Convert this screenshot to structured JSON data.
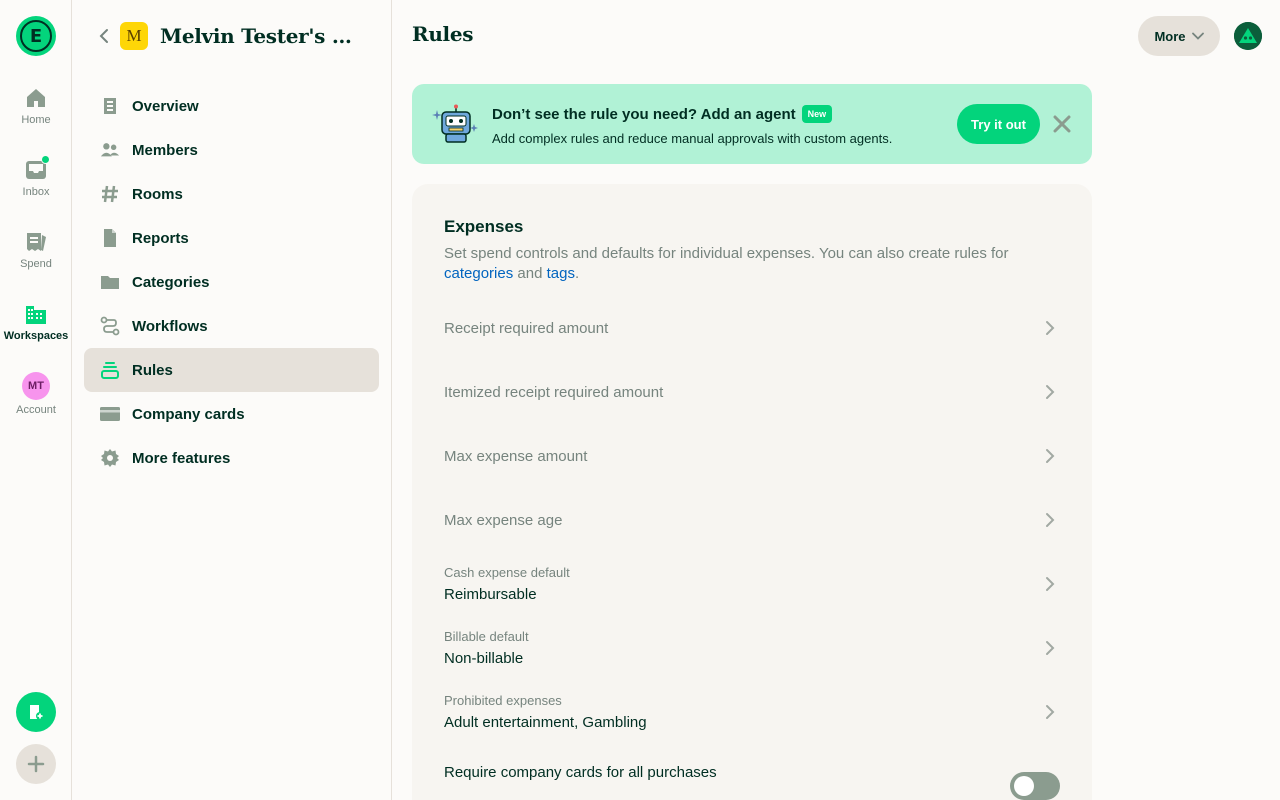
{
  "rail": {
    "logo_letter": "E",
    "items": [
      {
        "label": "Home",
        "icon": "home-icon"
      },
      {
        "label": "Inbox",
        "icon": "inbox-icon"
      },
      {
        "label": "Spend",
        "icon": "receipt-icon"
      },
      {
        "label": "Workspaces",
        "icon": "building-icon",
        "active": true
      },
      {
        "label": "Account",
        "icon": "avatar"
      }
    ],
    "account_initials": "MT"
  },
  "workspace": {
    "badge_letter": "M",
    "name": "Melvin Tester's Workspace"
  },
  "nav": {
    "items": [
      {
        "label": "Overview",
        "icon": "document-icon"
      },
      {
        "label": "Members",
        "icon": "users-icon"
      },
      {
        "label": "Rooms",
        "icon": "hashtag-icon"
      },
      {
        "label": "Reports",
        "icon": "file-icon"
      },
      {
        "label": "Categories",
        "icon": "folder-icon"
      },
      {
        "label": "Workflows",
        "icon": "workflow-icon"
      },
      {
        "label": "Rules",
        "icon": "rules-icon",
        "active": true
      },
      {
        "label": "Company cards",
        "icon": "card-icon"
      },
      {
        "label": "More features",
        "icon": "gear-icon"
      }
    ]
  },
  "header": {
    "title": "Rules",
    "more_label": "More"
  },
  "banner": {
    "title": "Don’t see the rule you need? Add an agent",
    "badge": "New",
    "subtitle": "Add complex rules and reduce manual approvals with custom agents.",
    "cta": "Try it out"
  },
  "expenses": {
    "title": "Expenses",
    "desc_prefix": "Set spend controls and defaults for individual expenses. You can also create rules for ",
    "link_categories": "categories",
    "desc_and": " and ",
    "link_tags": "tags",
    "desc_suffix": ".",
    "rows": [
      {
        "label": "Receipt required amount"
      },
      {
        "label": "Itemized receipt required amount"
      },
      {
        "label": "Max expense amount"
      },
      {
        "label": "Max expense age"
      },
      {
        "small": "Cash expense default",
        "value": "Reimbursable"
      },
      {
        "small": "Billable default",
        "value": "Non-billable"
      },
      {
        "small": "Prohibited expenses",
        "value": "Adult entertainment, Gambling"
      }
    ],
    "toggle_label": "Require company cards for all purchases",
    "toggle_on": false
  },
  "colors": {
    "accent": "#03d47c",
    "banner_bg": "#b1f2d6",
    "text": "#002e22",
    "muted": "#76847e",
    "link": "#0164bf"
  }
}
